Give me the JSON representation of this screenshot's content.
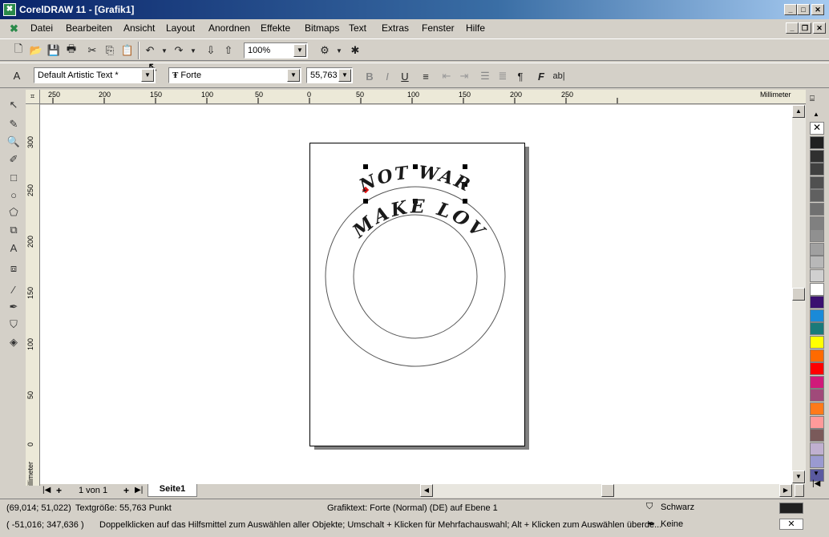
{
  "window": {
    "title": "CorelDRAW 11 - [Grafik1]"
  },
  "menu": [
    "Datei",
    "Bearbeiten",
    "Ansicht",
    "Layout",
    "Anordnen",
    "Effekte",
    "Bitmaps",
    "Text",
    "Extras",
    "Fenster",
    "Hilfe"
  ],
  "standard_toolbar": {
    "zoom": "100%"
  },
  "property_bar": {
    "style": "Default Artistic Text *",
    "font": "Forte",
    "font_size": "55,763"
  },
  "ruler_h": {
    "labels": [
      "250",
      "200",
      "150",
      "100",
      "50",
      "0",
      "50",
      "100",
      "150",
      "200",
      "250"
    ],
    "unit": "Millimeter"
  },
  "ruler_v": {
    "labels": [
      "300",
      "250",
      "200",
      "150",
      "100",
      "50",
      "0"
    ],
    "unit": "Millimeter"
  },
  "canvas": {
    "text_top": "NOT WAR",
    "text_bottom": "MAKE LOVE"
  },
  "pages": {
    "counter": "1 von 1",
    "tab": "Seite1"
  },
  "status": {
    "coords": "(69,014; 51,022)",
    "text_size": "Textgröße: 55,763 Punkt",
    "object_info": "Grafiktext: Forte (Normal) (DE) auf Ebene 1",
    "fill_name": "Schwarz",
    "outline_name": "Keine",
    "cursor": "( -51,016; 347,636 )",
    "hint": "Doppelklicken auf das Hilfsmittel zum Auswählen aller Objekte; Umschalt + Klicken für Mehrfachauswahl; Alt + Klicken zum Auswählen überde..."
  },
  "palette_colors": [
    "#202020",
    "#303030",
    "#404040",
    "#505050",
    "#606060",
    "#707070",
    "#808080",
    "#909090",
    "#a0a0a0",
    "#b8b8b8",
    "#d0d0d0",
    "#ffffff",
    "#3a1070",
    "#1a8ad8",
    "#1a7a7a",
    "#ffff00",
    "#ff6a00",
    "#ff0000",
    "#d01a7a",
    "#a04a7a",
    "#ff7a1a",
    "#ff9a9a",
    "#7a5a5a",
    "#c0b0d0",
    "#9a9ad0",
    "#5a5aa0"
  ]
}
